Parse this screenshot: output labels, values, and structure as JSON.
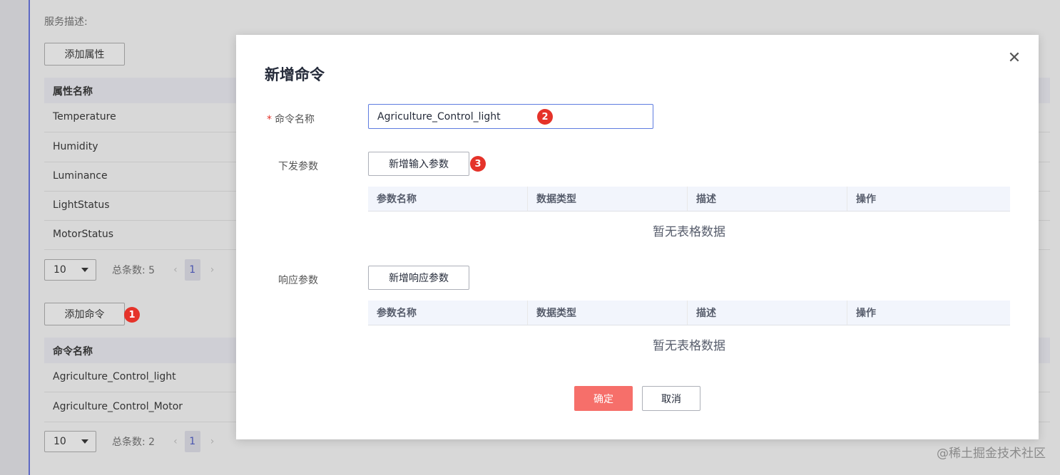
{
  "background": {
    "service_desc_label": "服务描述:",
    "add_property_button": "添加属性",
    "property_table": {
      "header": "属性名称",
      "rows": [
        "Temperature",
        "Humidity",
        "Luminance",
        "LightStatus",
        "MotorStatus"
      ]
    },
    "property_pager": {
      "page_size": "10",
      "total": "总条数: 5",
      "prev": "‹",
      "current": "1",
      "next": "›"
    },
    "add_command_button": "添加命令",
    "command_table": {
      "header": "命令名称",
      "rows": [
        "Agriculture_Control_light",
        "Agriculture_Control_Motor"
      ]
    },
    "command_pager": {
      "page_size": "10",
      "total": "总条数: 2",
      "prev": "‹",
      "current": "1",
      "next": "›"
    }
  },
  "modal": {
    "title": "新增命令",
    "close": "✕",
    "command_name_label": "命令名称",
    "required_mark": "*",
    "command_name_value": "Agriculture_Control_light",
    "send_params_label": "下发参数",
    "add_input_param_button": "新增输入参数",
    "params_table_headers": [
      "参数名称",
      "数据类型",
      "描述",
      "操作"
    ],
    "empty_text": "暂无表格数据",
    "response_params_label": "响应参数",
    "add_response_param_button": "新增响应参数",
    "response_table_headers": [
      "参数名称",
      "数据类型",
      "描述",
      "操作"
    ],
    "response_empty_text": "暂无表格数据",
    "confirm_button": "确定",
    "cancel_button": "取消"
  },
  "badges": {
    "one": "1",
    "two": "2",
    "three": "3"
  },
  "watermark": "@稀土掘金技术社区",
  "colors": {
    "accent_blue": "#5e7ce0",
    "confirm_red": "#f66f6a",
    "badge_red": "#e5332a"
  }
}
